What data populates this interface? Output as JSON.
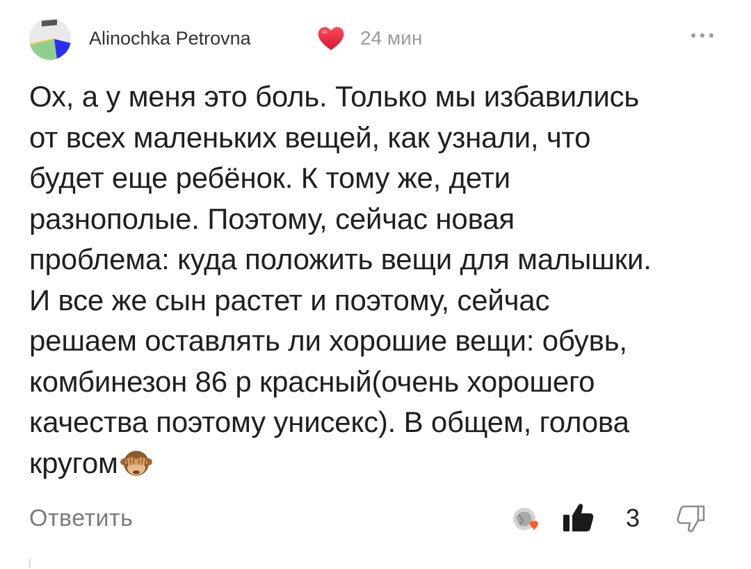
{
  "comment": {
    "author": {
      "name": "Alinochka Petrovna",
      "badge_icon": "heart-icon",
      "avatar_icon": "avatar"
    },
    "timestamp": "24 мин",
    "menu_icon": "more-dots-icon",
    "text_lines": [
      "Ох, а у меня это боль. Только мы избавились",
      "от всех маленьких вещей, как узнали, что",
      "будет еще ребёнок. К тому же, дети",
      "разнополые. Поэтому, сейчас новая",
      "проблема: куда положить вещи для малышки.",
      "И все же сын растет и поэтому, сейчас",
      "решаем оставлять ли хорошие вещи: обувь,",
      "комбинезон 86 р красный(очень хорошего",
      "качества поэтому унисекс). В общем, голова",
      "кругом"
    ],
    "trailing_emoji": "see-no-evil-monkey-icon"
  },
  "footer": {
    "reply_label": "Ответить",
    "like_count": "3",
    "like_icon": "thumbs-up-icon",
    "dislike_icon": "thumbs-down-icon"
  },
  "colors": {
    "text": "#1f1f1f",
    "muted": "#9a9a9a",
    "heart": "#e0243b",
    "like_dark": "#1a1a1a"
  }
}
